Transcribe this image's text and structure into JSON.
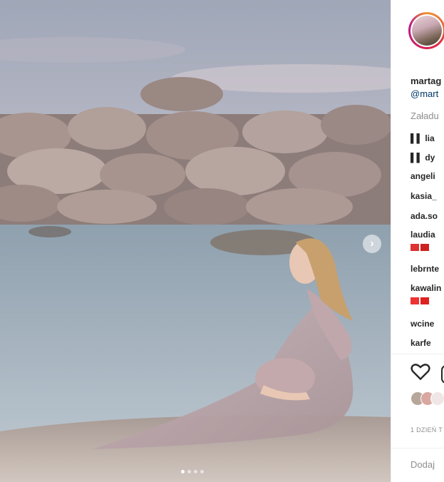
{
  "post": {
    "username": "martag",
    "handle": "@mart",
    "loading_text": "Załadu",
    "date": "1 DZIEŃ T",
    "add_comment_placeholder": "Dodaj"
  },
  "comments": [
    {
      "user": "▌▌ lia"
    },
    {
      "user": "▌▌ dy"
    },
    {
      "user": "angeli"
    },
    {
      "user": "kasia_"
    },
    {
      "user": "ada.so"
    },
    {
      "user": "laudia"
    },
    {
      "user": "lebrnte"
    },
    {
      "user": "kawalin"
    },
    {
      "user": "wcine"
    },
    {
      "user": "karfe"
    }
  ],
  "carousel": {
    "count": 4,
    "active": 0
  },
  "colors": {
    "link": "#00376b",
    "muted": "#8e8e8e",
    "text": "#262626",
    "ring": "#dc2743"
  },
  "icons": [
    "chevron-right-icon",
    "heart-icon",
    "comment-icon"
  ]
}
